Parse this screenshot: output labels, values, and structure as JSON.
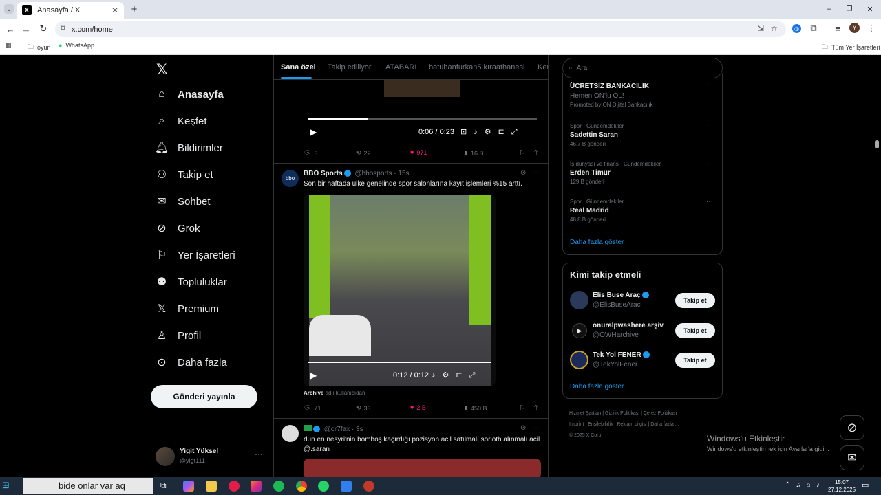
{
  "browser": {
    "tab_title": "Anasayfa / X",
    "url": "x.com/home",
    "bookmarks": [
      "oyun",
      "WhatsApp"
    ],
    "all_bookmarks": "Tüm Yer İşaretleri",
    "profile_initial": "Y"
  },
  "sidebar": {
    "items": [
      {
        "label": "Anasayfa"
      },
      {
        "label": "Keşfet"
      },
      {
        "label": "Bildirimler"
      },
      {
        "label": "Takip et"
      },
      {
        "label": "Sohbet"
      },
      {
        "label": "Grok"
      },
      {
        "label": "Yer İşaretleri"
      },
      {
        "label": "Topluluklar"
      },
      {
        "label": "Premium"
      },
      {
        "label": "Profil"
      },
      {
        "label": "Daha fazla"
      }
    ],
    "post_button": "Gönderi yayınla",
    "user": {
      "name": "Yigit Yüksel",
      "handle": "@yigt111"
    }
  },
  "feed": {
    "tabs": [
      "Sana özel",
      "Takip ediliyor",
      "ATABARI",
      "batuhanfurkan5 kıraathanesi",
      "Ker"
    ],
    "video1": {
      "time": "0:06 / 0:23",
      "progress": 0.26
    },
    "tweet1_stats": {
      "replies": "3",
      "reposts": "22",
      "likes": "971",
      "views": "16 B"
    },
    "tweet2": {
      "name": "BBO Sports",
      "handle": "@bbosports · 15s",
      "text": "Son bir haftada ülke genelinde spor salonlarına kayıt işlemleri %15 arttı.",
      "video_time": "0:12 / 0:12",
      "progress": 1.0,
      "source_bold": "Archive",
      "source_rest": "adlı kullanıcıdan",
      "stats": {
        "replies": "71",
        "reposts": "33",
        "likes": "2 B",
        "views": "450 B"
      }
    },
    "tweet3": {
      "handle": "@cr7fax · 3s",
      "text": "dün en nesyri'nin bomboş kaçırdığı pozisyon acil satılmalı sörloth alınmalı acil @.saran"
    }
  },
  "right": {
    "search_placeholder": "Ara",
    "promo": {
      "title": "ÜCRETSİZ BANKACILIK",
      "sub": "Hemen ON'lu OL!",
      "promoted": "Promoted by ON Dijital Bankacılık"
    },
    "trends": [
      {
        "meta": "Spor · Gündemdekiler",
        "name": "Sadettin Saran",
        "count": "46,7 B gönderi"
      },
      {
        "meta": "İş dünyası ve finans · Gündemdekiler",
        "name": "Erden Timur",
        "count": "129 B gönderi"
      },
      {
        "meta": "Spor · Gündemdekiler",
        "name": "Real Madrid",
        "count": "48,8 B gönderi"
      }
    ],
    "show_more": "Daha fazla göster",
    "who_to_follow": "Kimi takip etmeli",
    "follow": [
      {
        "name": "Elis Buse Araç",
        "handle": "@ElisBuseArac"
      },
      {
        "name": "onuralpwashere arşiv",
        "handle": "@OWHarchive"
      },
      {
        "name": "Tek Yol FENER",
        "handle": "@TekYolFener"
      }
    ],
    "follow_btn": "Takip et",
    "footer1": "Hizmet Şartları  |  Gizlilik Politikası  |  Çerez Politikası  |",
    "footer2": "Imprint  |  Erişilebilirlik  |  Reklam bilgisi  |  Daha fazla ...",
    "footer3": "© 2025 X Corp."
  },
  "activation": {
    "title": "Windows'u Etkinleştir",
    "sub": "Windows'u etkinleştirmek için Ayarlar'a gidin."
  },
  "taskbar": {
    "search_text": "bide onlar var aq",
    "time": "15:07",
    "date": "27.12.2025"
  }
}
